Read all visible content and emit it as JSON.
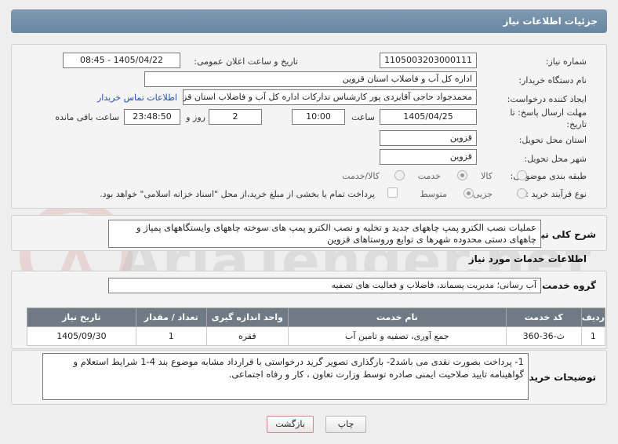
{
  "page_title": "جزئیات اطلاعات نیاز",
  "fields": {
    "need_number_label": "شماره نیاز:",
    "need_number": "1105003203000111",
    "announce_label": "تاریخ و ساعت اعلان عمومی:",
    "announce_value": "1405/04/22 - 08:45",
    "buyer_org_label": "نام دستگاه خریدار:",
    "buyer_org": "اداره کل آب و فاضلاب استان قزوین",
    "requester_label": "ایجاد کننده درخواست:",
    "requester": "محمدجواد حاجی آقایزدی پور کارشناس تدارکات اداره کل آب و فاضلاب استان قزوین",
    "buyer_contact_link": "اطلاعات تماس خریدار",
    "deadline_label": "مهلت ارسال پاسخ: تا تاریخ:",
    "deadline_date": "1405/04/25",
    "time_label": "ساعت",
    "deadline_time": "10:00",
    "days_value": "2",
    "days_label": "روز و",
    "remaining_value": "23:48:50",
    "remaining_label": "ساعت باقی مانده",
    "delivery_province_label": "استان محل تحویل:",
    "delivery_province": "قزوین",
    "delivery_city_label": "شهر محل تحویل:",
    "delivery_city": "قزوین",
    "category_label": "طبقه بندی موضوعی:",
    "category_options": [
      "کالا",
      "خدمت",
      "کالا/خدمت"
    ],
    "category_selected": "خدمت",
    "process_label": "نوع فرآیند خرید :",
    "process_options": [
      "جزیی",
      "متوسط"
    ],
    "process_selected": "متوسط",
    "payment_note": "پرداخت تمام یا بخشی از مبلغ خرید،از محل \"اسناد خزانه اسلامی\" خواهد بود."
  },
  "summary": {
    "label": "شرح کلی نیاز:",
    "text": "عملیات نصب الکترو پمپ چاههای جدید و تخلیه و نصب الکترو پمپ های سوخته چاههای  وایستگاههای پمپاژ و چاههای دستی  محدوده شهرها ی توابع وروستاهای  قزوین"
  },
  "services_section": {
    "title": "اطلاعات خدمات مورد نیاز",
    "group_label": "گروه خدمت:",
    "group_value": "آب رسانی؛ مدیریت پسماند، فاضلاب و فعالیت های تصفیه"
  },
  "table": {
    "headers": [
      "ردیف",
      "کد خدمت",
      "نام خدمت",
      "واحد اندازه گیری",
      "تعداد / مقدار",
      "تاریخ نیاز"
    ],
    "rows": [
      [
        "1",
        "ث-36-360",
        "جمع آوری، تصفیه و تامین آب",
        "فقره",
        "1",
        "1405/09/30"
      ]
    ]
  },
  "buyer_notes": {
    "label": "توضیحات خریدار:",
    "text": "1-    پرداخت بصورت نقدی می باشد2- بارگذاری تصویر گرید درخواستی با قرارداد مشابه موضوع بند 4-1 شرایط استعلام و گواهینامه تایید صلاحیت ایمنی صادره توسط وزارت تعاون ، کار و رفاه اجتماعی."
  },
  "buttons": {
    "print": "چاپ",
    "back": "بازگشت"
  },
  "watermark": "AriaTender.net",
  "colors": {
    "title_bar": "#6f8aa3",
    "table_header": "#6f7a84",
    "link": "#1f4fb3"
  }
}
